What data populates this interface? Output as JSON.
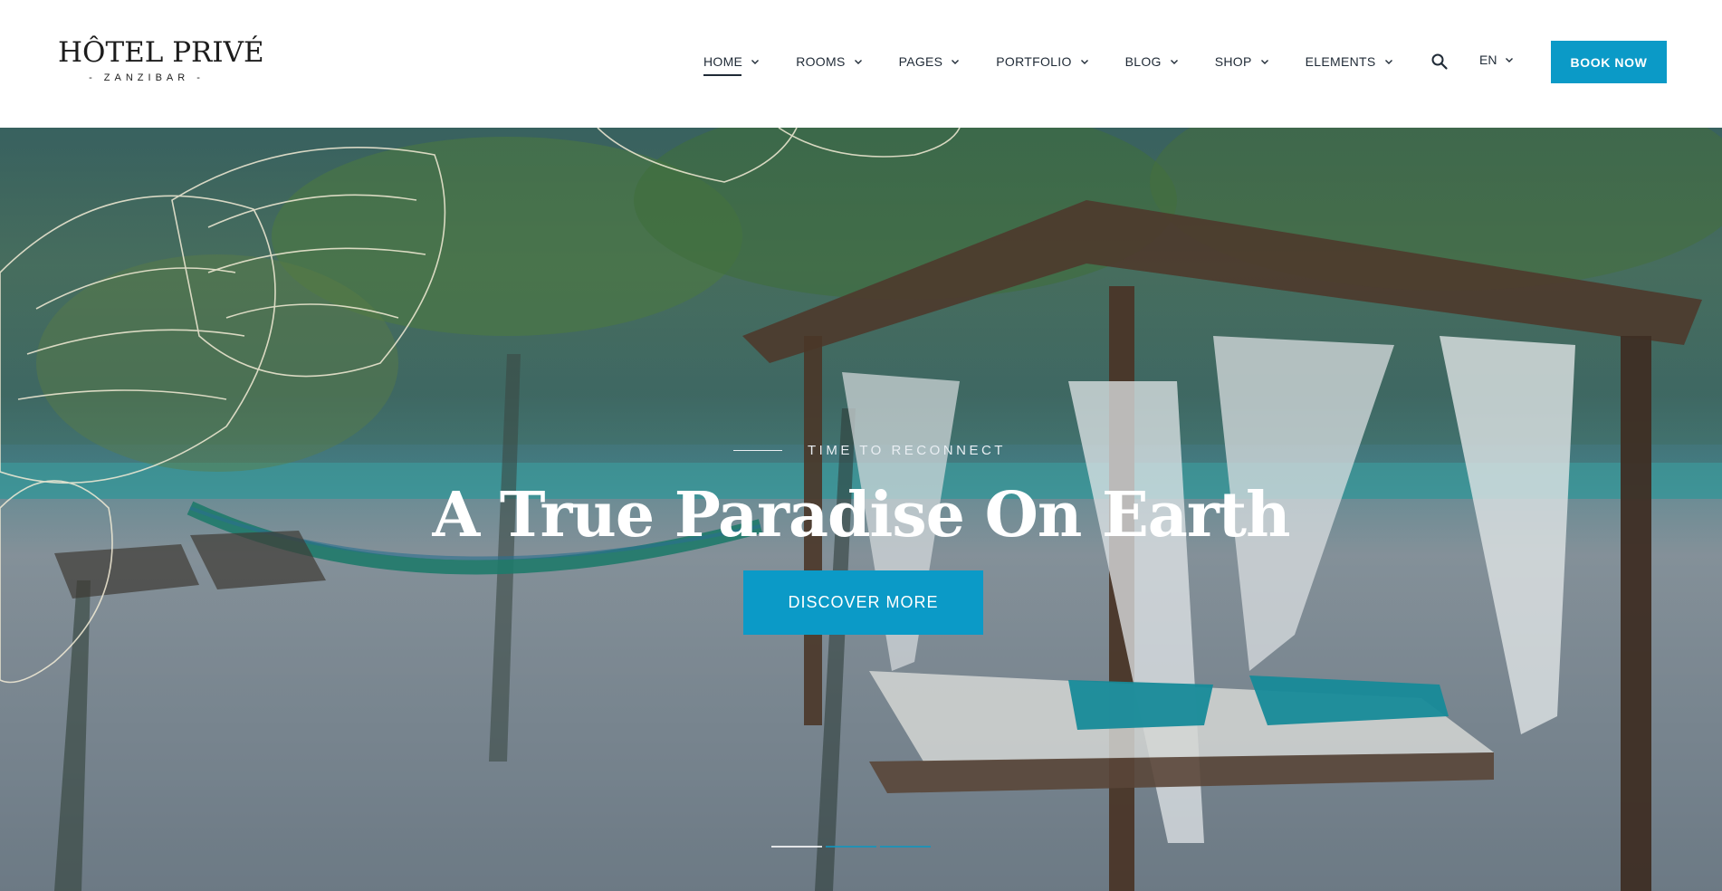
{
  "brand": {
    "name": "HÔTEL PRIVÉ",
    "tagline": "- ZANZIBAR -"
  },
  "nav": {
    "items": [
      {
        "label": "HOME",
        "active": true
      },
      {
        "label": "ROOMS",
        "active": false
      },
      {
        "label": "PAGES",
        "active": false
      },
      {
        "label": "PORTFOLIO",
        "active": false
      },
      {
        "label": "BLOG",
        "active": false
      },
      {
        "label": "SHOP",
        "active": false
      },
      {
        "label": "ELEMENTS",
        "active": false
      }
    ],
    "search_icon": "search-icon",
    "language": "EN",
    "book_label": "BOOK NOW"
  },
  "hero": {
    "eyebrow": "TIME TO RECONNECT",
    "title": "A True Paradise On Earth",
    "cta_label": "DISCOVER MORE",
    "slides_total": 3,
    "active_slide": 1
  },
  "colors": {
    "accent": "#0b9ac7",
    "nav_text": "#1f2a36",
    "white": "#ffffff"
  }
}
